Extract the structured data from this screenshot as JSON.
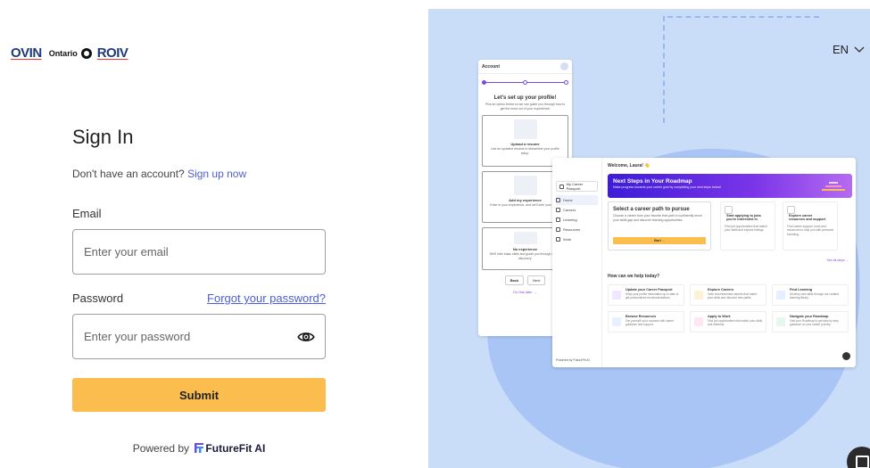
{
  "branding": {
    "ovin": "OVIN",
    "ontario": "Ontario",
    "roiv": "ROIV"
  },
  "signin": {
    "title": "Sign In",
    "no_account": "Don't have an account?",
    "signup_link": "Sign up now",
    "email_label": "Email",
    "email_placeholder": "Enter your email",
    "password_label": "Password",
    "forgot_link": "Forgot your password?",
    "password_placeholder": "Enter your password",
    "submit_label": "Submit",
    "powered_by": "Powered by",
    "powered_brand": "FutureFit AI"
  },
  "language": {
    "selected": "EN",
    "icon": "chevron-down-icon"
  },
  "preview_account": {
    "header": "Account",
    "avatar_initial": "L",
    "title": "Let's set up your profile!",
    "subtitle": "Pick an option below so we can guide you through how to get the most out of your experience!",
    "options": [
      {
        "title": "Upload a resume",
        "desc": "Use an updated resume to streamline your profile setup."
      },
      {
        "title": "Add my experience",
        "desc": "Enter in your experience, and we'll infer your skills."
      },
      {
        "title": "No experience",
        "desc": "We'll infer basic skills and guide you through career discovery."
      }
    ],
    "back": "Back",
    "next": "Next",
    "skip": "Do this later →"
  },
  "preview_dashboard": {
    "welcome": "Welcome, Laura! 👋",
    "career_passport": "My Career Passport",
    "nav": [
      "Home",
      "Careers",
      "Learning",
      "Resources",
      "Work"
    ],
    "hero_title": "Next Steps in Your Roadmap",
    "hero_sub": "Make progress towards your career goal by completing your next steps below!",
    "career_title": "Select a career path to pursue",
    "career_desc": "Choose a career from your favorite that path to confidently move your skills gap and discover learning opportunities.",
    "start": "Start →",
    "mini_cards": [
      {
        "title": "Start applying to jobs you're interested in",
        "desc": "Find job opportunities that match your skills and explore listings."
      },
      {
        "title": "Explore career resources and support",
        "desc": "Find career support, tools and resources to help you with personal branding."
      }
    ],
    "see_all": "See all steps →",
    "help_title": "How can we help today?",
    "tiles": [
      {
        "title": "Update your Career Passport",
        "desc": "Keep your profile information up to date to get personalized recommendations."
      },
      {
        "title": "Explore Careers",
        "desc": "View recommended careers that match your skills and discover new paths."
      },
      {
        "title": "Find Learning",
        "desc": "Develop new skills through our curated learning library."
      },
      {
        "title": "Browse Resources",
        "desc": "Get yourself up to success with career guidance and support."
      },
      {
        "title": "Apply to Work",
        "desc": "Find job opportunities that match your skills and interests."
      },
      {
        "title": "Navigate your Roadmap",
        "desc": "Visit your Roadmap to get step by step guidance on your career journey."
      }
    ],
    "powered": "Powered by FutureFit AI"
  },
  "colors": {
    "accent": "#fbbd4e",
    "link": "#4b5fd6",
    "panel_bg": "#c9dcf8",
    "brand_navy": "#1d3a7a"
  }
}
